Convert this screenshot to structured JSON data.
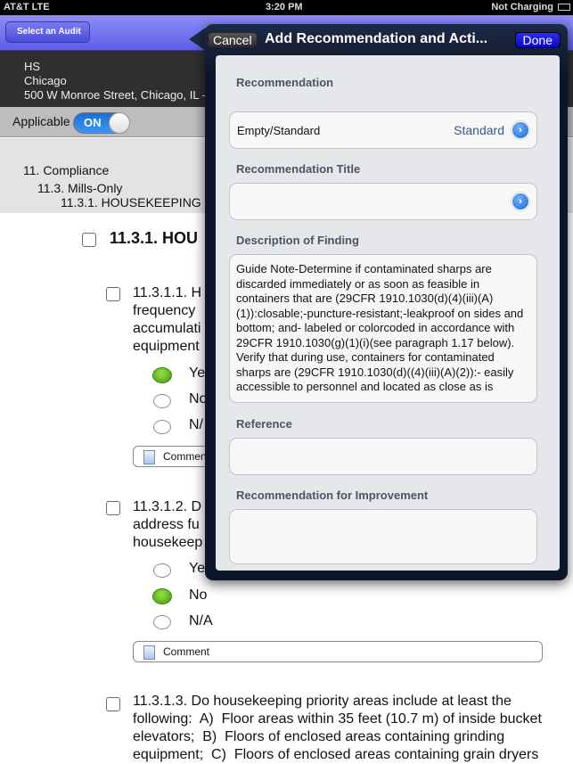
{
  "status_bar": {
    "carrier": "AT&T  LTE",
    "time": "3:20 PM",
    "battery": "Not Charging"
  },
  "nav": {
    "back": "Select an Audit"
  },
  "site": {
    "name": "HS",
    "city": "Chicago",
    "address": "500 W Monroe Street, Chicago, IL -"
  },
  "applicable": {
    "label": "Applicable",
    "state": "ON"
  },
  "breadcrumb": [
    "11. Compliance",
    "11.3. Mills-Only",
    "11.3.1. HOUSEKEEPING"
  ],
  "section_heading": "11.3.1. HOU",
  "questions": [
    {
      "text": "11.3.1.1. H\nfrequency \naccumulati\nequipment",
      "options": [
        "Ye",
        "No",
        "N/"
      ],
      "selected": 0,
      "comment": "Commen"
    },
    {
      "text": "11.3.1.2. D\naddress fu\nhousekeep",
      "options": [
        "Ye",
        "No",
        "N/A"
      ],
      "selected": 1,
      "comment": "Comment"
    },
    {
      "text": "11.3.1.3. Do housekeeping priority areas include at least the\nfollowing:  A)  Floor areas within 35 feet (10.7 m) of inside bucket\nelevators;  B)  Floors of enclosed areas containing grinding\nequipment;  C)  Floors of enclosed areas containing grain dryers"
    }
  ],
  "popover": {
    "cancel": "Cancel",
    "title": "Add Recommendation and Acti...",
    "done": "Done",
    "recommendation_label": "Recommendation",
    "recommendation_field": "Empty/Standard",
    "recommendation_value": "Standard",
    "title_label": "Recommendation Title",
    "title_value": "",
    "description_label": "Description of Finding",
    "description": "Guide Note-Determine if contaminated sharps are discarded immediately or as soon as feasible in containers that are (29CFR 1910.1030(d)(4)(iii)(A)(1)):closable;-puncture-resistant;-leakproof on sides and bottom; and- labeled or colorcoded in accordance with 29CFR 1910.1030(g)(1)(i)(see paragraph 1.17 below). Verify that during use, containers for contaminated sharps are (29CFR 1910.1030(d)((4)(iii)(A)(2)):- easily accessible to personnel and located as close as is",
    "reference_label": "Reference",
    "reference_value": "",
    "improvement_label": "Recommendation for Improvement",
    "improvement_value": ""
  },
  "colors": {
    "nav": "#6f6ff0",
    "done": "#1010e0",
    "toggle": "#2a7fe6",
    "selected_radio": "#4caf10"
  }
}
